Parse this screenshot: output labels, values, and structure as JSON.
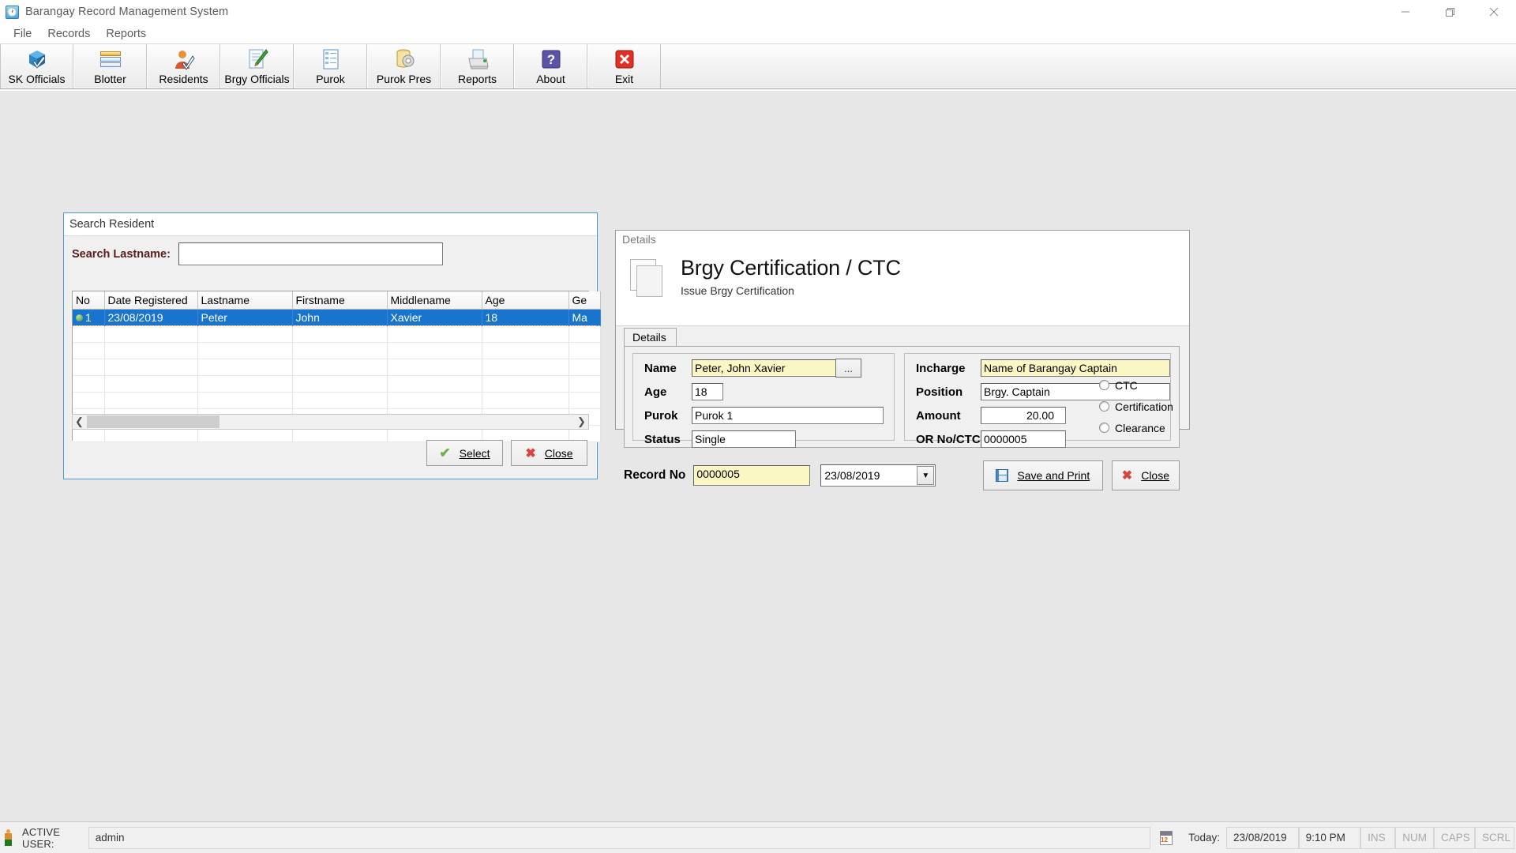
{
  "window": {
    "title": "Barangay Record Management System",
    "app_icon": "clock-icon",
    "minimize": "−",
    "restore": "❐",
    "close": "✕"
  },
  "menubar": {
    "items": [
      {
        "label": "File"
      },
      {
        "label": "Records"
      },
      {
        "label": "Reports"
      }
    ]
  },
  "toolbar": {
    "buttons": [
      {
        "label": "SK Officials",
        "icon": "blue-cube-check-icon"
      },
      {
        "label": "Blotter",
        "icon": "stacked-bars-icon"
      },
      {
        "label": "Residents",
        "icon": "person-check-icon"
      },
      {
        "label": "Brgy Officials",
        "icon": "document-pencil-icon"
      },
      {
        "label": "Purok",
        "icon": "list-document-icon"
      },
      {
        "label": "Purok Pres",
        "icon": "database-gear-icon"
      },
      {
        "label": "Reports",
        "icon": "printer-icon"
      },
      {
        "label": "About",
        "icon": "question-mark-icon"
      },
      {
        "label": "Exit",
        "icon": "red-x-icon"
      }
    ]
  },
  "search_window": {
    "title": "Search Resident",
    "search_label": "Search Lastname:",
    "search_value": "",
    "search_placeholder": "",
    "grid": {
      "columns": [
        "No",
        "Date Registered",
        "Lastname",
        "Firstname",
        "Middlename",
        "Age",
        "Ge"
      ],
      "rows": [
        {
          "selected": true,
          "cells": [
            "1",
            "23/08/2019",
            "Peter",
            "John",
            "Xavier",
            "18",
            "Ma"
          ]
        }
      ],
      "empty_row_count": 10
    },
    "scrollbar": {
      "left_arrow": "❮",
      "right_arrow": "❯"
    },
    "buttons": {
      "select": {
        "label": "Select",
        "accel": "S",
        "icon": "green-check-icon"
      },
      "close": {
        "label": "Close",
        "accel": "C",
        "icon": "red-x-icon"
      }
    }
  },
  "details_window": {
    "caption": "Details",
    "header": {
      "icon": "document-pages-icon",
      "title": "Brgy Certification / CTC",
      "subtitle": "Issue Brgy Certification"
    },
    "tab": {
      "label": "Details"
    },
    "left_group": {
      "fields": [
        {
          "label": "Name",
          "value": "Peter, John Xavier",
          "highlight": true,
          "has_browse": true,
          "browse_label": "..."
        },
        {
          "label": "Age",
          "value": "18",
          "highlight": false
        },
        {
          "label": "Purok",
          "value": "Purok 1",
          "highlight": false
        },
        {
          "label": "Status",
          "value": "Single",
          "highlight": false
        }
      ]
    },
    "right_group": {
      "fields": [
        {
          "label": "Incharge",
          "value": "Name of Barangay Captain",
          "highlight": true
        },
        {
          "label": "Position",
          "value": "Brgy. Captain",
          "highlight": false
        },
        {
          "label": "Amount",
          "value": "20.00",
          "highlight": false,
          "align": "right"
        },
        {
          "label": "OR No/CTC",
          "value": "0000005",
          "highlight": false
        }
      ],
      "radios": [
        {
          "label": "CTC",
          "checked": false
        },
        {
          "label": "Certification",
          "checked": false
        },
        {
          "label": "Clearance",
          "checked": false
        }
      ]
    },
    "record_bar": {
      "record_label": "Record No",
      "record_value": "0000005",
      "date_value": "23/08/2019",
      "dropdown_arrow": "▼",
      "save_button": {
        "label": "Save and Print",
        "accel": "S",
        "icon": "floppy-disk-icon"
      },
      "close_button": {
        "label": "Close",
        "accel": "C",
        "icon": "red-x-icon"
      }
    }
  },
  "statusbar": {
    "user_icon": "person-icon",
    "active_user_label": "ACTIVE USER:",
    "active_user_value": "admin",
    "calendar_icon": "calendar-icon",
    "today_label": "Today:",
    "today_date": "23/08/2019",
    "today_time": "9:10 PM",
    "indicators": [
      "INS",
      "NUM",
      "CAPS",
      "SCRL"
    ]
  },
  "colors": {
    "selection_blue": "#1874CD",
    "highlight_yellow": "#fbf7c4",
    "label_maroon": "#5a1b1b",
    "window_border_blue": "#4a9ad4"
  }
}
